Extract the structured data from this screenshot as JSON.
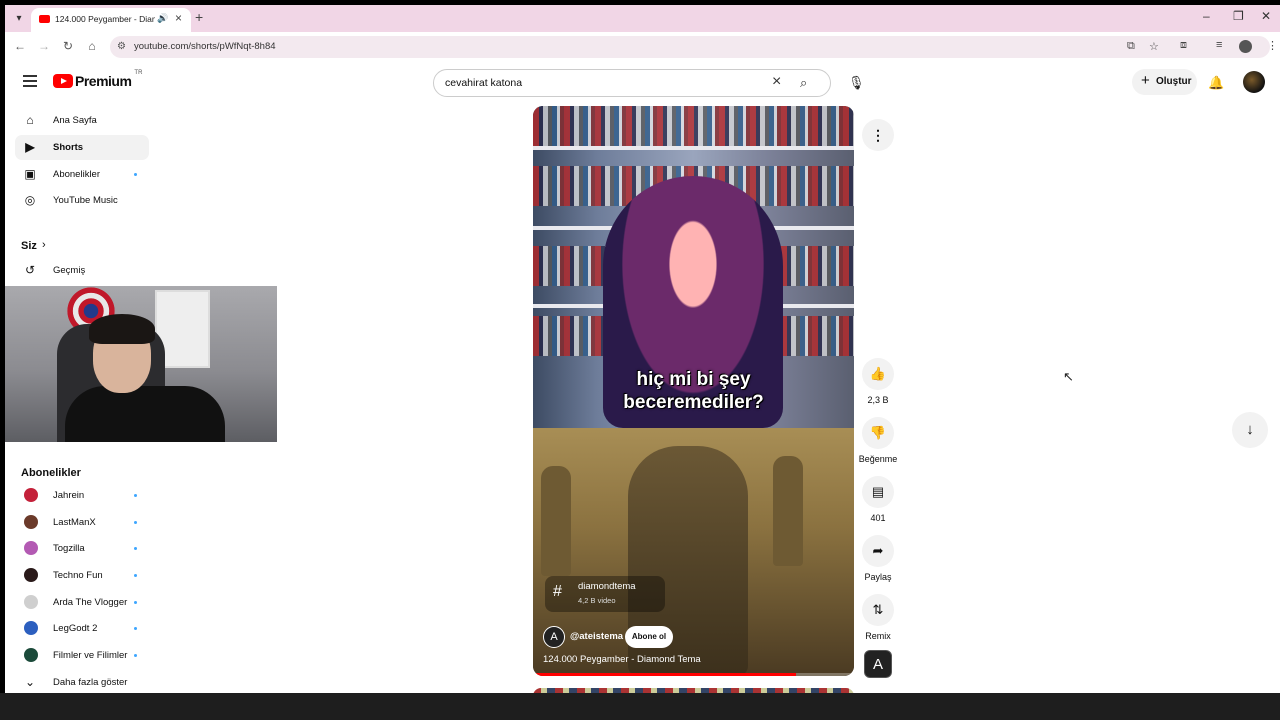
{
  "browser": {
    "tab_title": "124.000 Peygamber - Diam",
    "url": "youtube.com/shorts/pWfNqt-8h84"
  },
  "masthead": {
    "logo_text": "Premium",
    "country_code": "TR",
    "search_value": "cevahirat katona",
    "create_label": "Oluştur"
  },
  "sidebar": {
    "items": [
      {
        "label": "Ana Sayfa",
        "icon": "home-icon"
      },
      {
        "label": "Shorts",
        "icon": "shorts-icon",
        "active": true
      },
      {
        "label": "Abonelikler",
        "icon": "subscriptions-icon",
        "dot": true
      },
      {
        "label": "YouTube Music",
        "icon": "music-icon"
      }
    ],
    "you_label": "Siz",
    "history_label": "Geçmiş",
    "subs_title": "Abonelikler",
    "channels": [
      {
        "name": "Jahrein",
        "color": "#c4213a"
      },
      {
        "name": "LastManX",
        "color": "#6b3a2a"
      },
      {
        "name": "Togzilla",
        "color": "#b35ab3"
      },
      {
        "name": "Techno Fun",
        "color": "#2a1a1a"
      },
      {
        "name": "Arda The Vlogger",
        "color": "#cfcfcf"
      },
      {
        "name": "LegGodt 2",
        "color": "#2c5fbf"
      },
      {
        "name": "Filmler ve Filimler",
        "color": "#1b4a3a"
      }
    ],
    "show_more_label": "Daha fazla göster"
  },
  "short": {
    "caption_line1": "hiç mi bi şey",
    "caption_line2": "beceremediler?",
    "hashtag": "diamondtema",
    "hashtag_count": "4,2 B video",
    "channel_handle": "@ateistema",
    "subscribe_label": "Abone ol",
    "title": "124.000 Peygamber - Diamond Tema",
    "progress_fraction": 0.82
  },
  "actions": {
    "like_count": "2,3 B",
    "dislike_label": "Beğenme",
    "comment_count": "401",
    "share_label": "Paylaş",
    "remix_label": "Remix"
  },
  "colors": {
    "accent": "#ff0000",
    "link_dot": "#3ea6ff"
  }
}
